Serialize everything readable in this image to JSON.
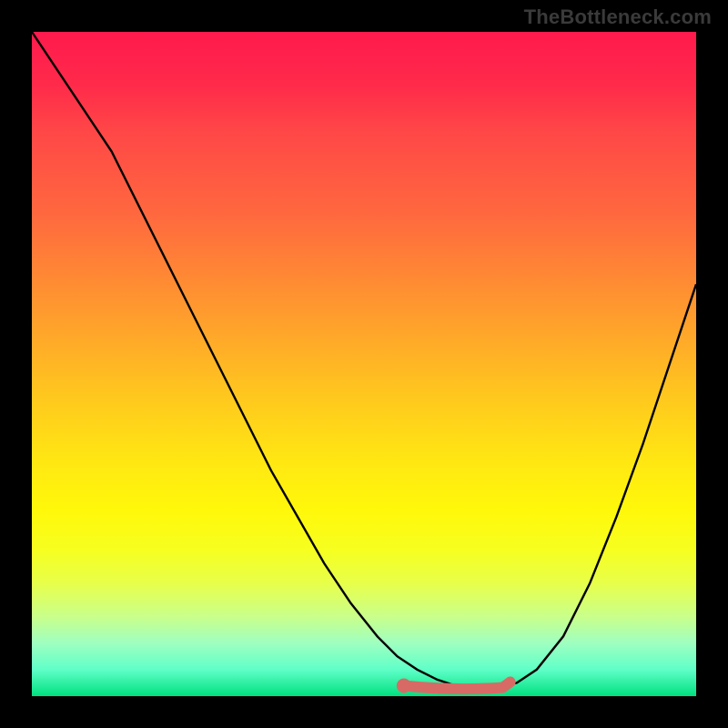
{
  "watermark": "TheBottleneck.com",
  "colors": {
    "frame": "#000000",
    "curve": "#000000",
    "marker": "#d86a66",
    "gradient_top": "#ff1a4d",
    "gradient_bottom": "#00e07e"
  },
  "chart_data": {
    "type": "line",
    "title": "",
    "xlabel": "",
    "ylabel": "",
    "xlim": [
      0,
      100
    ],
    "ylim": [
      0,
      100
    ],
    "grid": false,
    "series": [
      {
        "name": "bottleneck-curve",
        "x": [
          0,
          4,
          8,
          12,
          16,
          20,
          24,
          28,
          32,
          36,
          40,
          44,
          48,
          52,
          55,
          58,
          61,
          64,
          67,
          70,
          73,
          76,
          80,
          84,
          88,
          92,
          96,
          100
        ],
        "values": [
          100,
          94,
          88,
          82,
          74,
          66,
          58,
          50,
          42,
          34,
          27,
          20,
          14,
          9,
          6,
          4,
          2.5,
          1.5,
          1.2,
          1.3,
          2,
          4,
          9,
          17,
          27,
          38,
          50,
          62
        ]
      }
    ],
    "annotations": [
      {
        "name": "optimal-marker",
        "x_range": [
          56,
          72
        ],
        "y": 1.3
      }
    ],
    "legend": false
  }
}
